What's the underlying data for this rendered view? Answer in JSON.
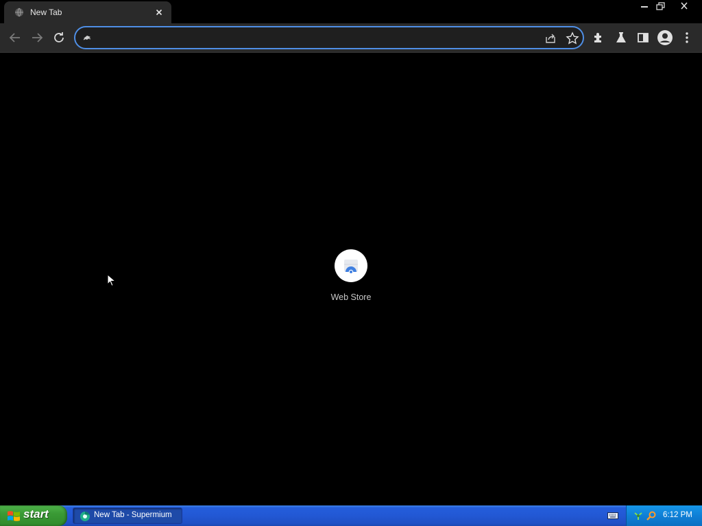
{
  "browser": {
    "tab": {
      "title": "New Tab",
      "favicon": "globe-icon",
      "close_icon": "close-icon"
    },
    "window_controls": [
      "minimize-icon",
      "restore-icon",
      "close-icon"
    ],
    "toolbar": {
      "nav_icons": [
        "back-arrow-icon",
        "forward-arrow-icon",
        "reload-icon"
      ],
      "omnibox": {
        "value": "",
        "placeholder": "",
        "leading_icon": "search-engine-icon",
        "accent_color": "#4f8fe6"
      },
      "omnibox_action_icons": [
        "share-icon",
        "star-icon"
      ],
      "right_icons": [
        "extensions-puzzle-icon",
        "labs-flask-icon",
        "side-panel-icon",
        "profile-avatar-icon",
        "kebab-menu-icon"
      ]
    }
  },
  "new_tab_page": {
    "shortcuts": [
      {
        "label": "Web Store",
        "icon": "web-store-icon"
      }
    ]
  },
  "taskbar": {
    "start_label": "start",
    "start_icon": "windows-logo-icon",
    "tasks": [
      {
        "label": "New Tab - Supermium",
        "icon": "supermium-icon"
      }
    ],
    "tray_icons": [
      "keyboard-icon",
      "network-icon",
      "search-icon"
    ],
    "clock": "6:12 PM",
    "colors": {
      "taskbar": "#2258d4",
      "start": "#3a9a35",
      "tray": "#0f7fd6"
    }
  }
}
